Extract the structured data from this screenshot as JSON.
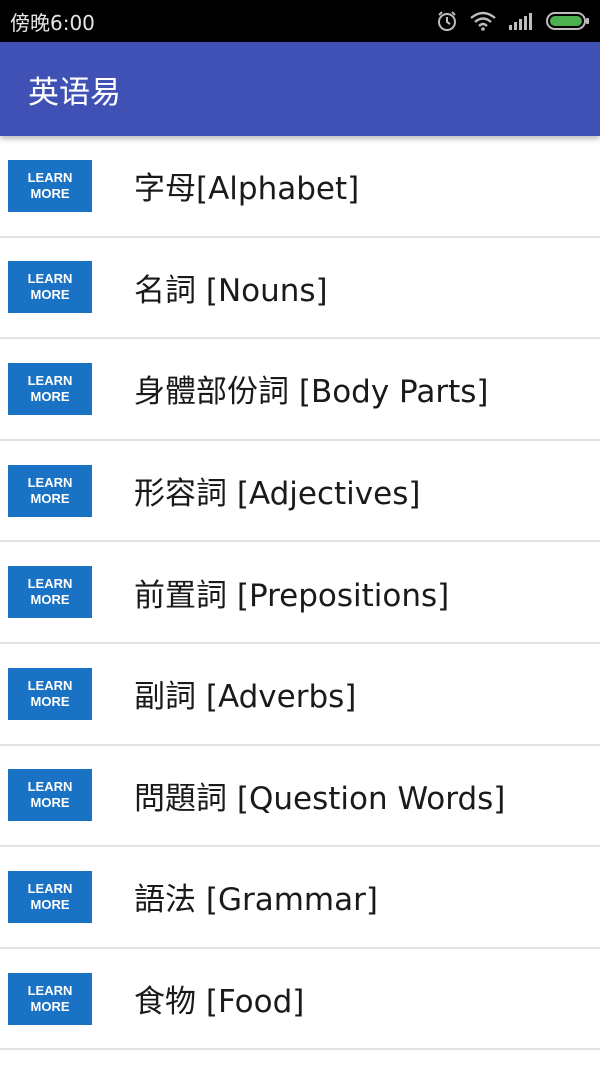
{
  "status_bar": {
    "time": "傍晚6:00",
    "icons": [
      "alarm-icon",
      "wifi-icon",
      "signal-icon",
      "battery-icon"
    ]
  },
  "app_bar": {
    "title": "英语易",
    "color": "#3f51b5"
  },
  "badge": {
    "line1": "LEARN",
    "line2": "MORE",
    "color": "#1a72c5"
  },
  "items": [
    {
      "label": "字母[Alphabet]"
    },
    {
      "label": "名詞 [Nouns]"
    },
    {
      "label": "身體部份詞 [Body Parts]"
    },
    {
      "label": "形容詞 [Adjectives]"
    },
    {
      "label": "前置詞 [Prepositions]"
    },
    {
      "label": "副詞 [Adverbs]"
    },
    {
      "label": "問題詞 [Question Words]"
    },
    {
      "label": "語法 [Grammar]"
    },
    {
      "label": "食物 [Food]"
    }
  ]
}
